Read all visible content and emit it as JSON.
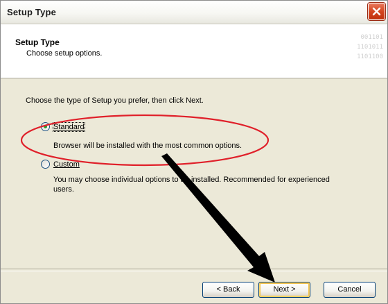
{
  "window": {
    "title": "Setup Type"
  },
  "header": {
    "title": "Setup Type",
    "subtitle": "Choose setup options.",
    "binary_lines": [
      "001101",
      "1101011",
      "1101100"
    ]
  },
  "content": {
    "prompt": "Choose the type of Setup you prefer, then click Next.",
    "options": [
      {
        "label": "Standard",
        "selected": true,
        "description": "Browser will be installed with the most common options."
      },
      {
        "label": "Custom",
        "selected": false,
        "description_line1": "You may choose individual options to be installed. Recommended for experienced",
        "description_line2": "users."
      }
    ]
  },
  "buttons": {
    "back": "< Back",
    "next": "Next >",
    "cancel": "Cancel"
  },
  "colors": {
    "annotation_ellipse": "#e0202a",
    "arrow": "#000000",
    "close_button": "#d4451f"
  }
}
